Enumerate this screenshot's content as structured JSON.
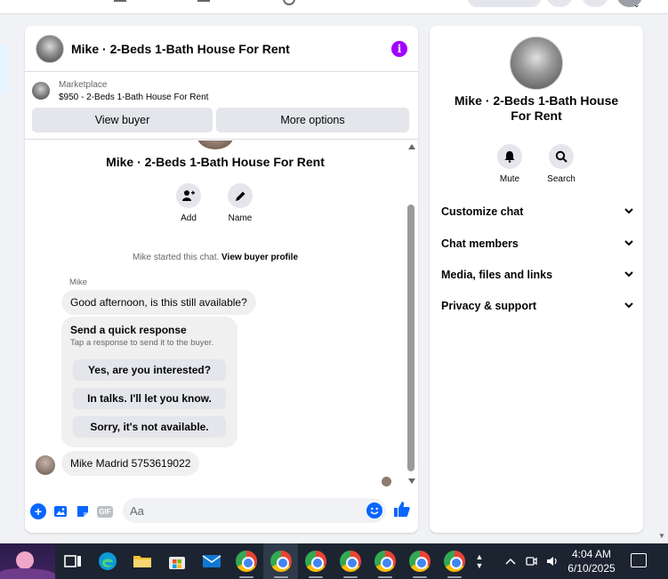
{
  "chat": {
    "title": "Mike · 2-Beds 1-Bath House For Rent",
    "listing": {
      "source": "Marketplace",
      "price_line": "$950 - 2-Beds 1-Bath House For Rent"
    },
    "buttons": {
      "view_buyer": "View buyer",
      "more_options": "More options"
    },
    "conversation_title": "Mike · 2-Beds 1-Bath House For Rent",
    "actions": {
      "add": "Add",
      "name": "Name"
    },
    "started_text": "Mike started this chat.",
    "view_profile_link": "View buyer profile",
    "sender_name": "Mike",
    "message1": "Good afternoon, is this still available?",
    "quick_response": {
      "title": "Send a quick response",
      "subtitle": "Tap a response to send it to the buyer.",
      "options": [
        "Yes, are you interested?",
        "In talks. I'll let you know.",
        "Sorry, it's not available."
      ]
    },
    "message2": "Mike Madrid 5753619022",
    "composer": {
      "placeholder": "Aa"
    }
  },
  "details": {
    "title": "Mike · 2-Beds 1-Bath House For Rent",
    "actions": {
      "mute": "Mute",
      "search": "Search"
    },
    "sections": [
      "Customize chat",
      "Chat members",
      "Media, files and links",
      "Privacy & support"
    ]
  },
  "taskbar": {
    "time": "4:04 AM",
    "date": "6/10/2025"
  },
  "colors": {
    "accent": "#0866ff",
    "info_purple": "#a100ff",
    "taskbar_bg": "#1c2431"
  }
}
